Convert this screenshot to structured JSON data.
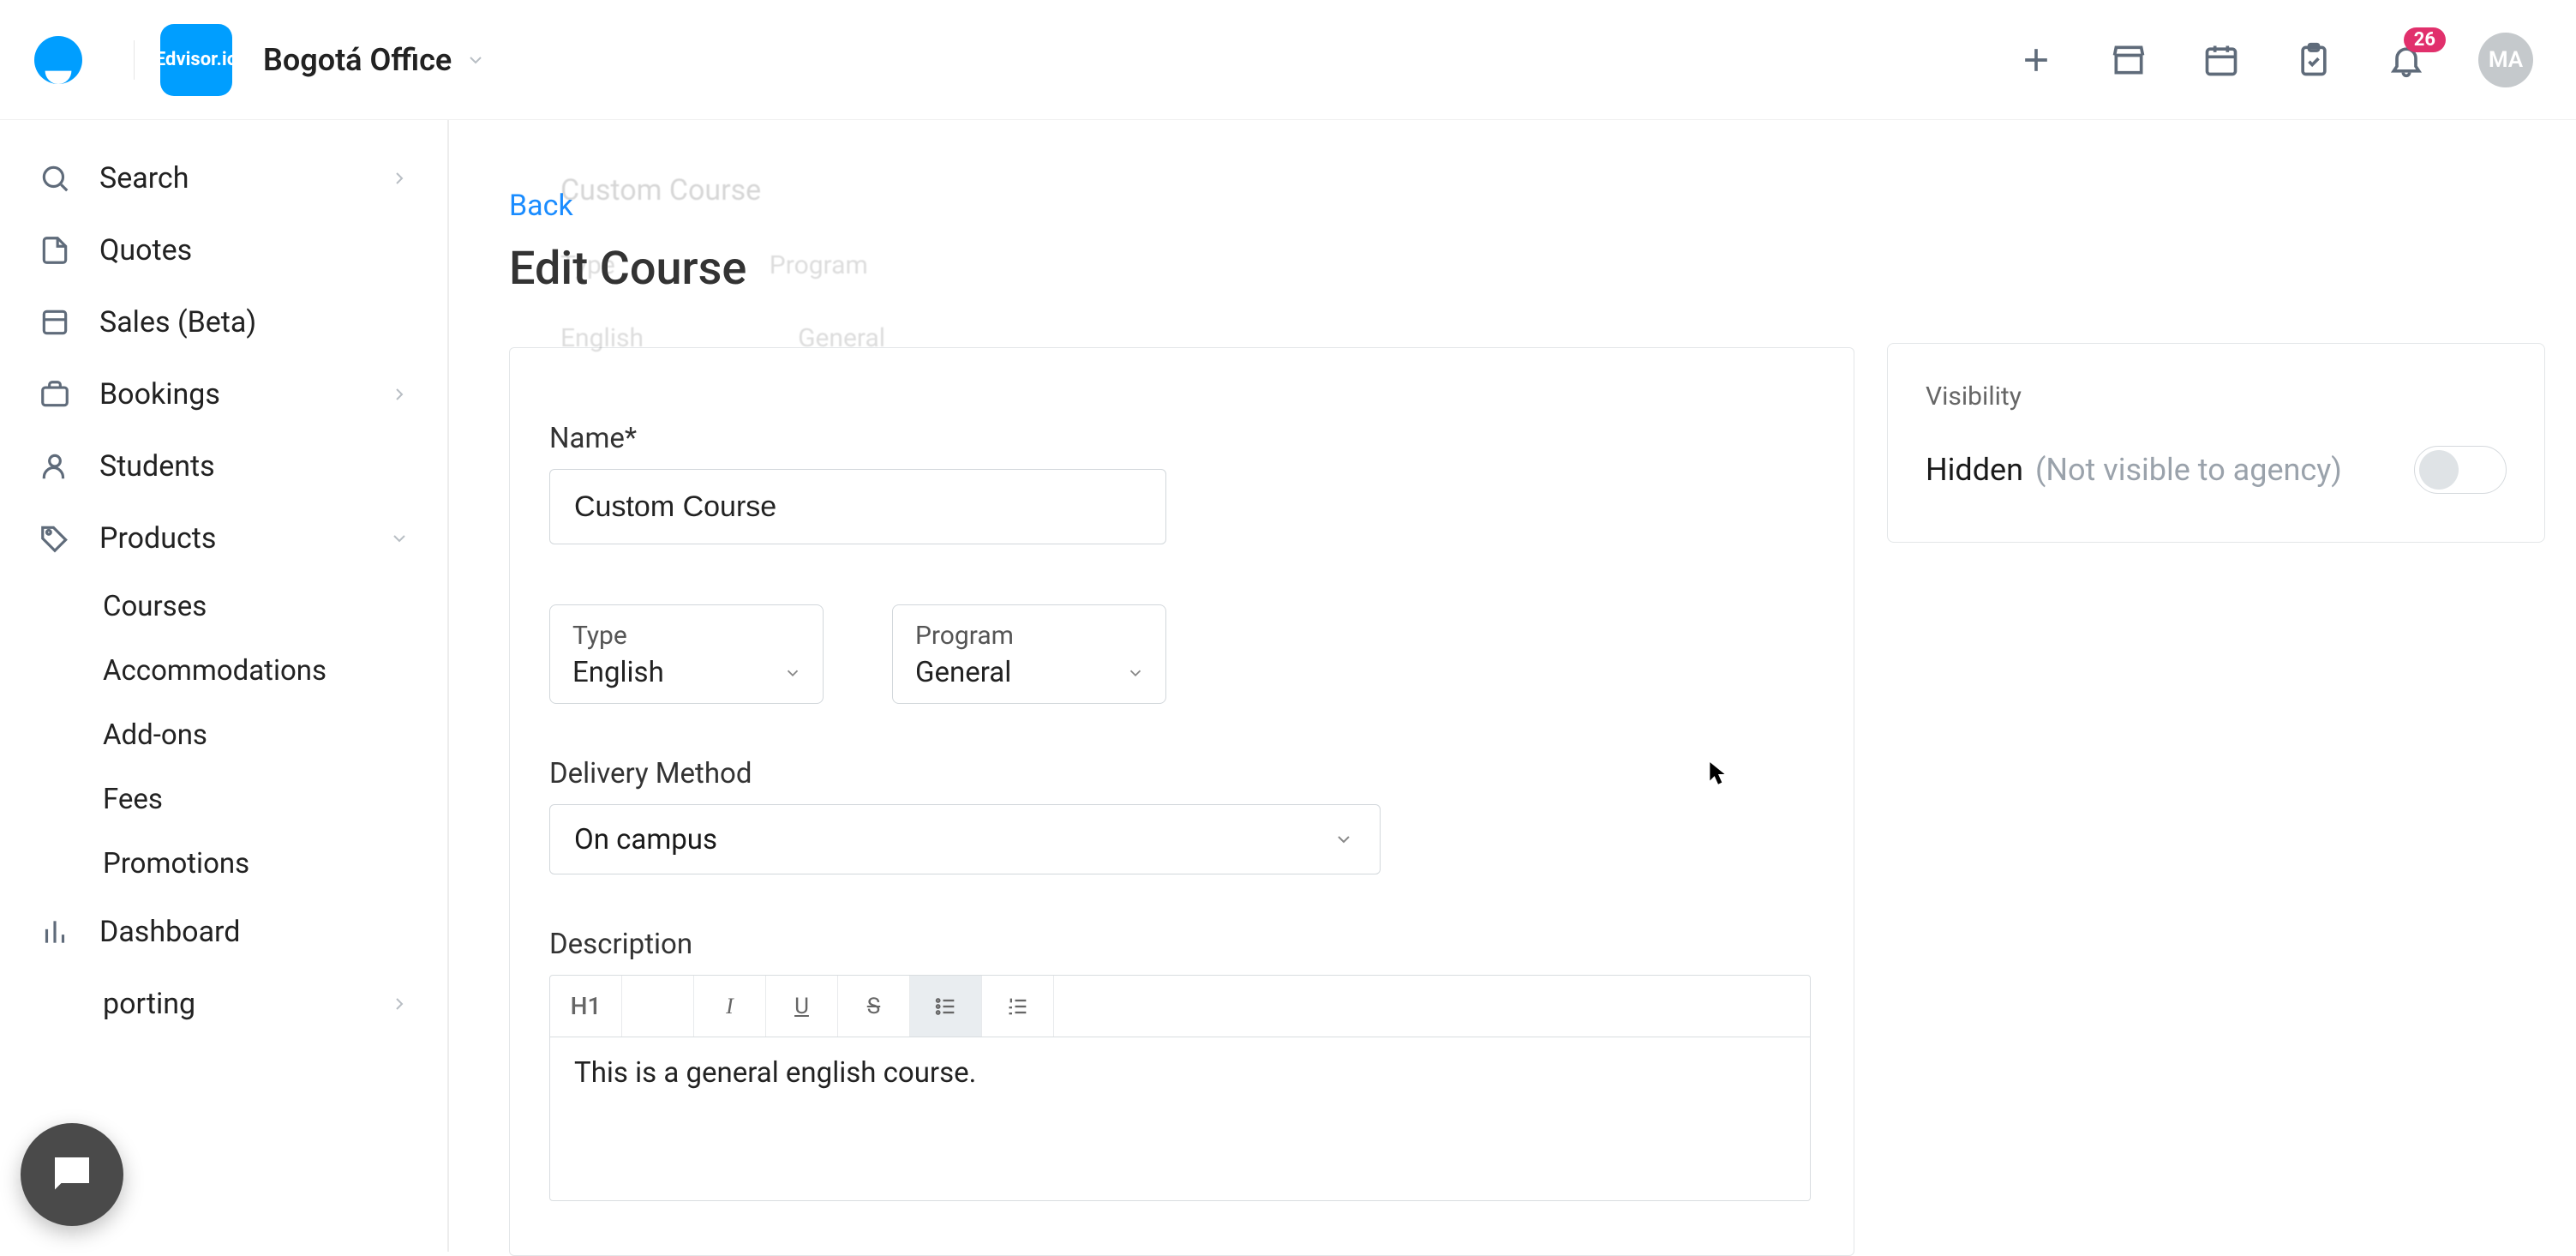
{
  "header": {
    "brand": "Edvisor.io",
    "office": "Bogotá Office",
    "notification_count": "26",
    "avatar_initials": "MA"
  },
  "sidebar": {
    "search": "Search",
    "quotes": "Quotes",
    "sales": "Sales (Beta)",
    "bookings": "Bookings",
    "students": "Students",
    "products": "Products",
    "products_children": {
      "courses": "Courses",
      "accommodations": "Accommodations",
      "addons": "Add-ons",
      "fees": "Fees",
      "promotions": "Promotions"
    },
    "dashboard": "Dashboard",
    "reporting": "porting"
  },
  "page": {
    "back": "Back",
    "title": "Edit Course",
    "name_label": "Name*",
    "name_value": "Custom Course",
    "type_label": "Type",
    "type_value": "English",
    "program_label": "Program",
    "program_value": "General",
    "delivery_label": "Delivery Method",
    "delivery_value": "On campus",
    "description_label": "Description",
    "description_value": "This is a general english course.",
    "rte": {
      "h1": "H1",
      "italic": "I",
      "underline": "U",
      "strike": "S"
    }
  },
  "visibility": {
    "title": "Visibility",
    "state": "Hidden",
    "note": "(Not visible to agency)"
  }
}
